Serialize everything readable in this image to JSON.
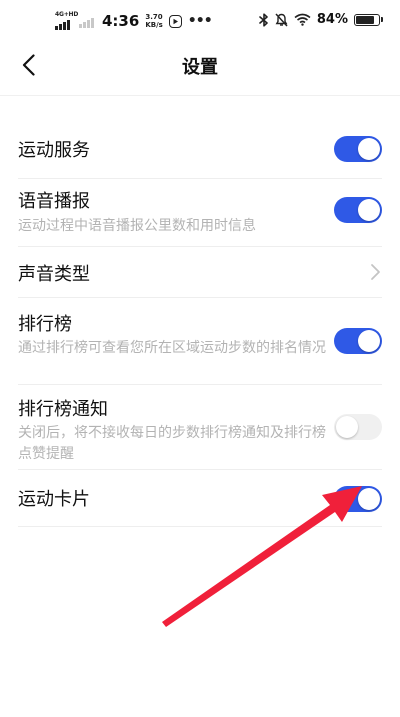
{
  "status_bar": {
    "network": "4G+HD",
    "time": "4:36",
    "speed_value": "3.70",
    "speed_unit": "KB/s",
    "battery": "84%",
    "icons": [
      "signal-icon",
      "app-notification-icon",
      "more-dots-icon",
      "bluetooth-icon",
      "mute-icon",
      "wifi-icon",
      "battery-icon"
    ]
  },
  "header": {
    "back_icon": "chevron-left-icon",
    "title": "设置"
  },
  "settings": [
    {
      "label": "运动服务",
      "description": "",
      "control": "toggle",
      "on": true
    },
    {
      "label": "语音播报",
      "description": "运动过程中语音播报公里数和用时信息",
      "control": "toggle",
      "on": true
    },
    {
      "label": "声音类型",
      "description": "",
      "control": "chevron-right-icon"
    },
    {
      "label": "排行榜",
      "description": "通过排行榜可查看您所在区域运动步数的排名情况",
      "control": "toggle",
      "on": true
    },
    {
      "label": "排行榜通知",
      "description": "关闭后，将不接收每日的步数排行榜通知及排行榜点赞提醒",
      "control": "toggle",
      "on": false
    },
    {
      "label": "运动卡片",
      "description": "",
      "control": "toggle",
      "on": true
    }
  ],
  "colors": {
    "toggle_on": "#2f59e6",
    "toggle_off": "#f0f0f0",
    "annotation_arrow": "#f0203a",
    "description_text": "#b3b3b3"
  }
}
